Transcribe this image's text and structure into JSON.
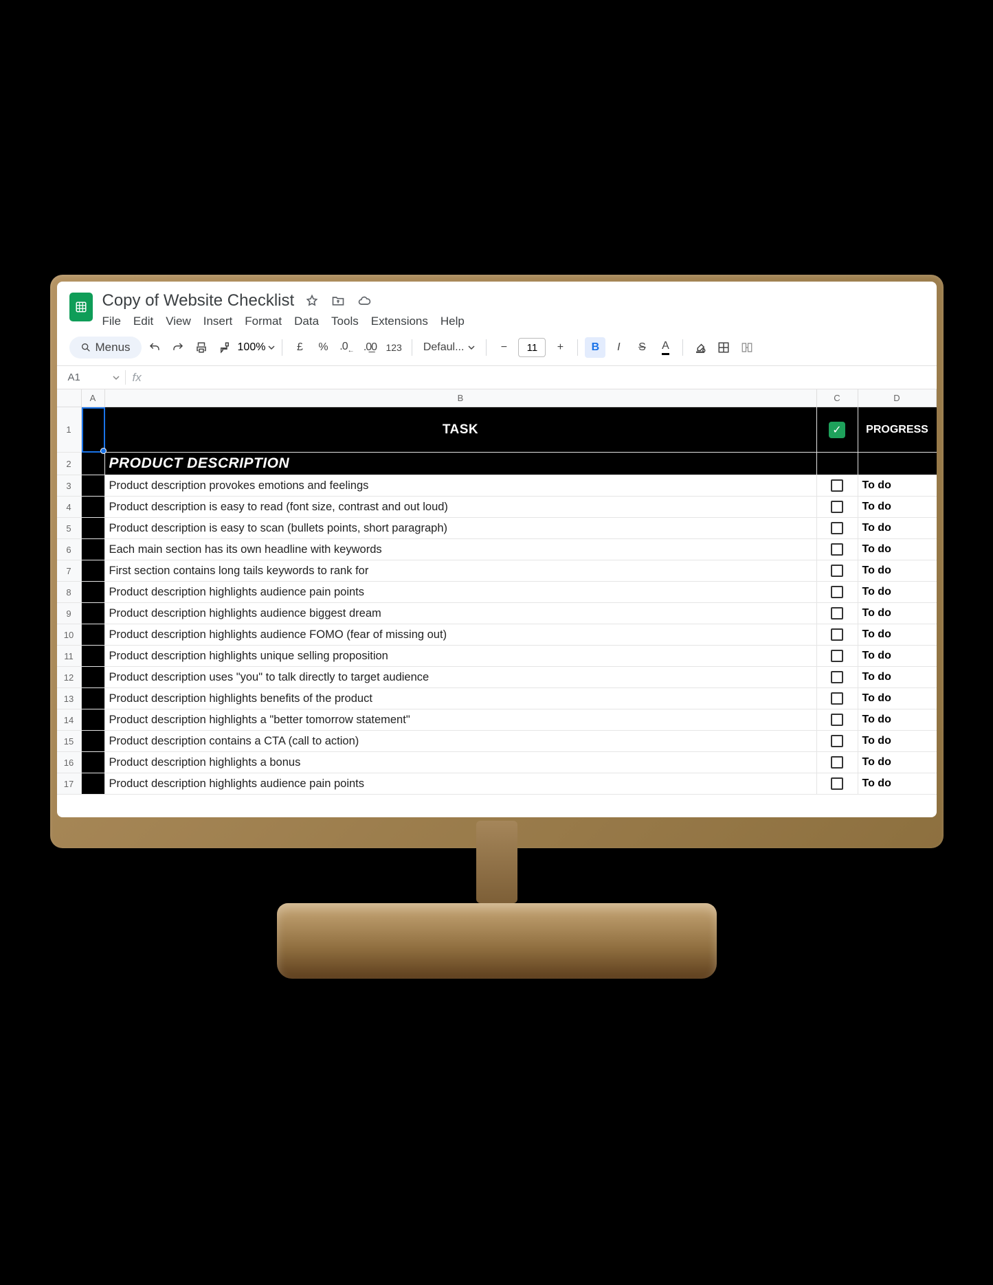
{
  "doc": {
    "title": "Copy of Website Checklist"
  },
  "menus": [
    "File",
    "Edit",
    "View",
    "Insert",
    "Format",
    "Data",
    "Tools",
    "Extensions",
    "Help"
  ],
  "toolbar": {
    "search_label": "Menus",
    "zoom": "100%",
    "currency": "£",
    "percent": "%",
    "dec_dec": ".0",
    "dec_inc": ".00",
    "format_123": "123",
    "font": "Defaul...",
    "font_size": "11"
  },
  "namebox": "A1",
  "columns": {
    "a": "A",
    "b": "B",
    "c": "C",
    "d": "D"
  },
  "header_row": {
    "task": "TASK",
    "progress": "PROGRESS"
  },
  "section_title": "PRODUCT DESCRIPTION",
  "progress_default": "To do",
  "rows": [
    {
      "n": 3,
      "task": "Product description provokes emotions and feelings"
    },
    {
      "n": 4,
      "task": "Product description is easy to read (font size, contrast and out loud)"
    },
    {
      "n": 5,
      "task": "Product description is easy to scan (bullets points, short paragraph)"
    },
    {
      "n": 6,
      "task": "Each main section has its own headline with keywords"
    },
    {
      "n": 7,
      "task": "First section contains long tails keywords to rank for"
    },
    {
      "n": 8,
      "task": "Product description highlights audience pain points"
    },
    {
      "n": 9,
      "task": "Product description highlights audience biggest dream"
    },
    {
      "n": 10,
      "task": "Product description highlights audience FOMO (fear of missing out)"
    },
    {
      "n": 11,
      "task": "Product description highlights unique selling proposition"
    },
    {
      "n": 12,
      "task": "Product description uses \"you\" to talk directly to target audience"
    },
    {
      "n": 13,
      "task": "Product description highlights benefits of the product"
    },
    {
      "n": 14,
      "task": "Product description highlights a \"better tomorrow statement\""
    },
    {
      "n": 15,
      "task": "Product description contains a CTA (call to action)"
    },
    {
      "n": 16,
      "task": "Product description highlights a bonus"
    },
    {
      "n": 17,
      "task": "Product description highlights audience pain points"
    }
  ]
}
